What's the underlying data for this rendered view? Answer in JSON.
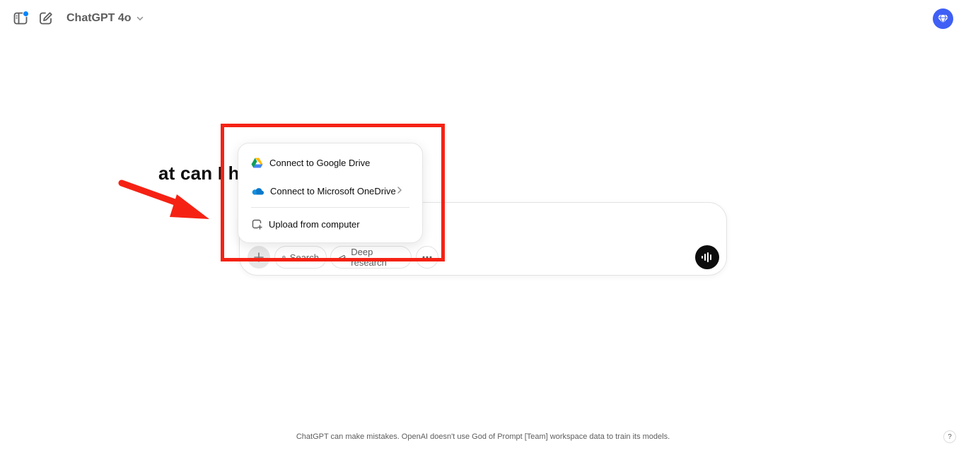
{
  "header": {
    "model_label": "ChatGPT 4o"
  },
  "main": {
    "heading": "at can I help with?"
  },
  "composer": {
    "pills": {
      "search": "Search",
      "deep_research": "Deep research"
    }
  },
  "attach_menu": {
    "items": [
      {
        "label": "Connect to Google Drive",
        "icon": "google-drive-icon"
      },
      {
        "label": "Connect to Microsoft OneDrive",
        "icon": "onedrive-icon"
      },
      {
        "label": "Upload from computer",
        "icon": "upload-file-icon"
      }
    ]
  },
  "footer": {
    "disclaimer": "ChatGPT can make mistakes. OpenAI doesn't use God of Prompt [Team] workspace data to train its models.",
    "help": "?"
  },
  "colors": {
    "accent": "#3f5ff5",
    "annotation": "#f52214",
    "notification": "#0285ff"
  }
}
